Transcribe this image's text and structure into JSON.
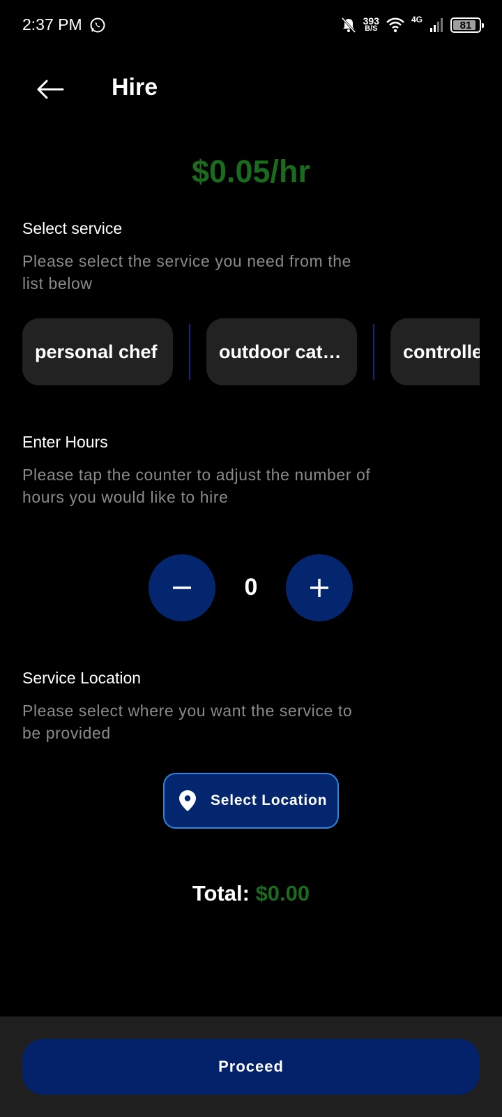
{
  "status_bar": {
    "time": "2:37 PM",
    "net_speed": "393",
    "net_unit": "B/S",
    "network": "4G",
    "battery": "81"
  },
  "header": {
    "title": "Hire"
  },
  "rate": "$0.05/hr",
  "service": {
    "title": "Select service",
    "description": "Please select the service you need from the list below",
    "chips": [
      {
        "label": "personal chef"
      },
      {
        "label": "outdoor catering"
      },
      {
        "label": "controlled"
      }
    ]
  },
  "hours": {
    "title": "Enter Hours",
    "description": "Please tap the counter to adjust the number of hours you would like to hire",
    "value": "0"
  },
  "location": {
    "title": "Service Location",
    "description": "Please select where you want the service to be provided",
    "button_label": "Select Location"
  },
  "total": {
    "label": "Total:",
    "amount": "$0.00"
  },
  "footer": {
    "proceed_label": "Proceed"
  },
  "colors": {
    "accent_green": "#1b6b1f",
    "primary_blue": "#03266e",
    "outline_blue": "#2f86e0"
  }
}
